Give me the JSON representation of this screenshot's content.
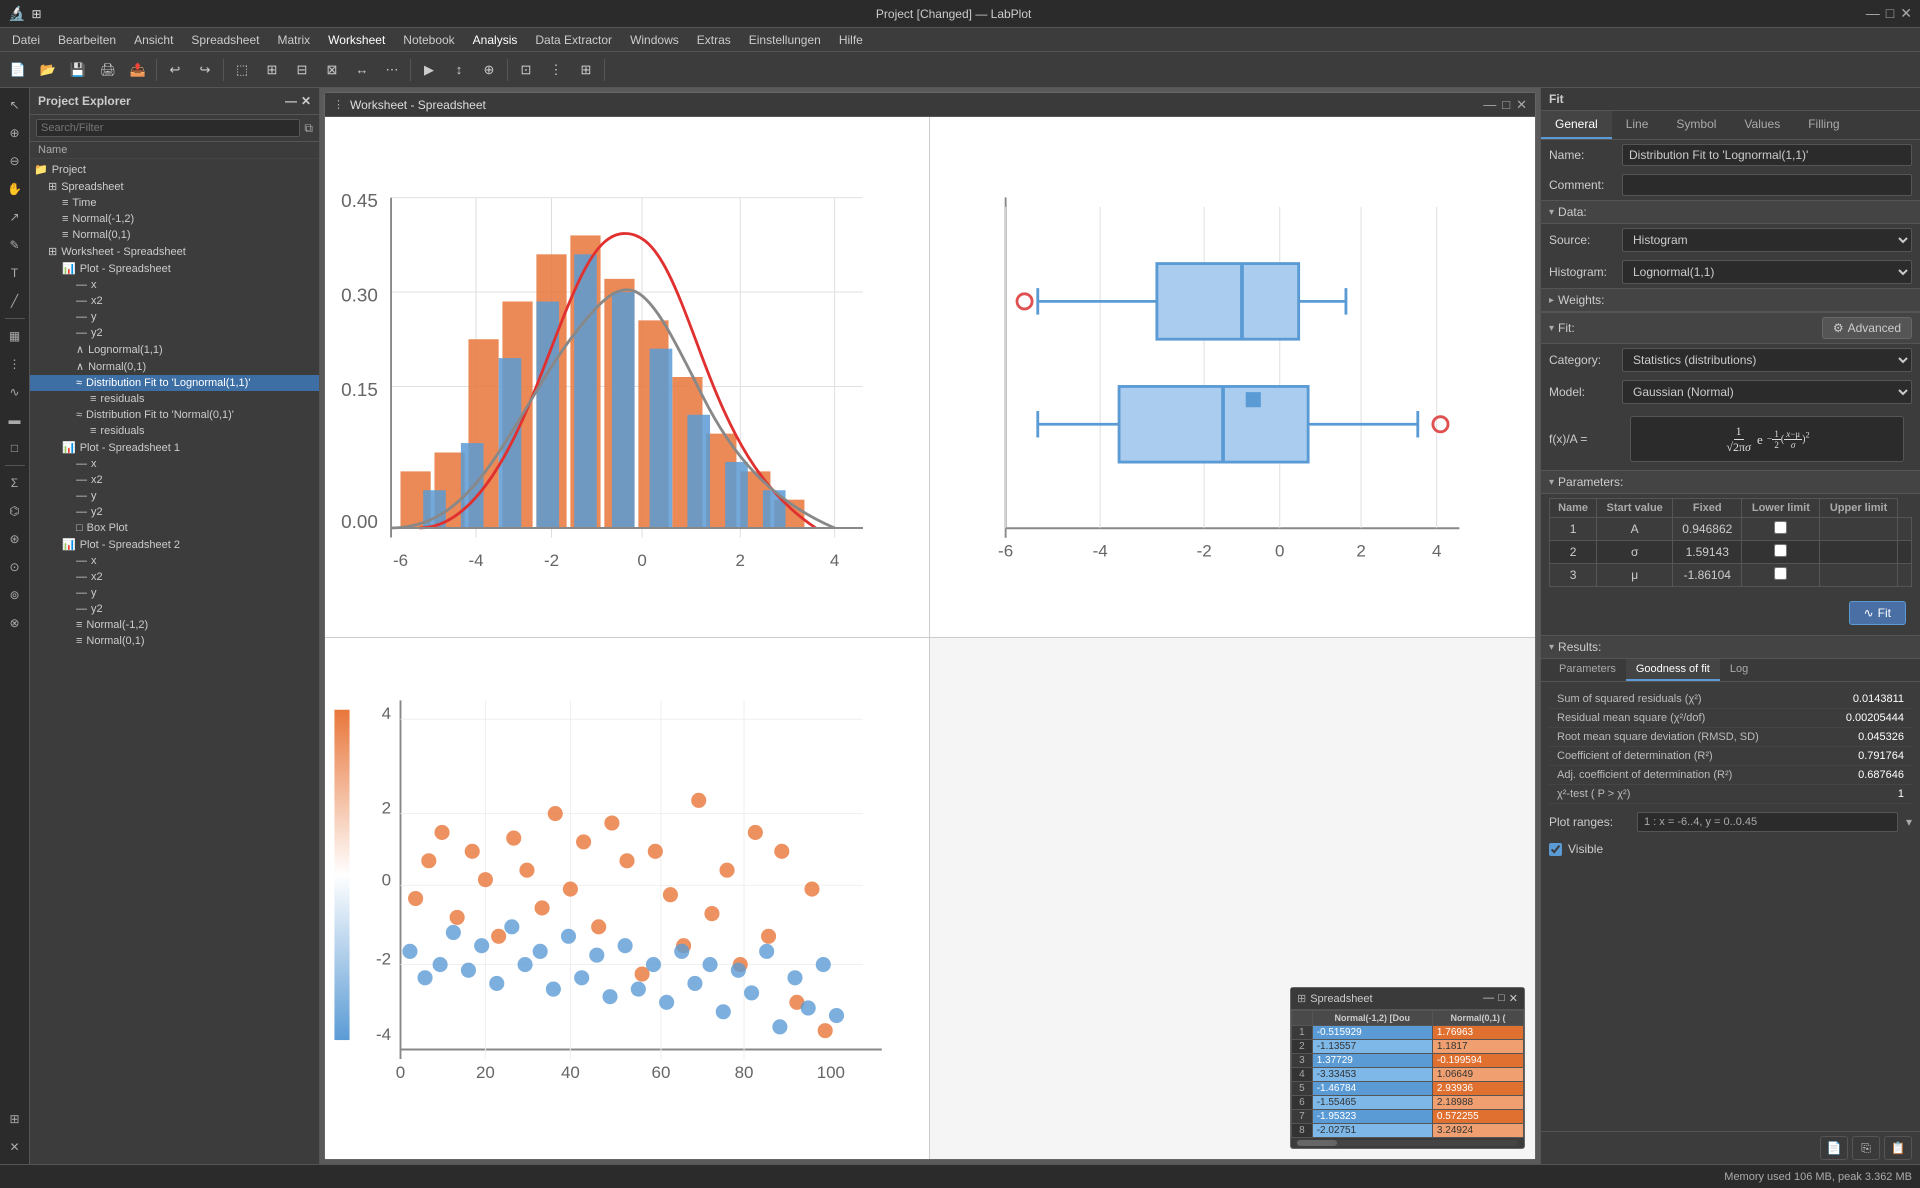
{
  "titlebar": {
    "title": "Project [Changed] — LabPlot",
    "minimize": "—",
    "maximize": "□",
    "close": "✕"
  },
  "menubar": {
    "items": [
      "Datei",
      "Bearbeiten",
      "Ansicht",
      "Spreadsheet",
      "Matrix",
      "Worksheet",
      "Notebook",
      "Analysis",
      "Data Extractor",
      "Windows",
      "Extras",
      "Einstellungen",
      "Hilfe"
    ]
  },
  "sidebar": {
    "header": "Project Explorer",
    "search_placeholder": "Search/Filter",
    "col_header": "Name",
    "tree": [
      {
        "label": "Project",
        "indent": 0,
        "icon": "📁"
      },
      {
        "label": "Spreadsheet",
        "indent": 1,
        "icon": "⊞"
      },
      {
        "label": "Time",
        "indent": 2,
        "icon": "≡"
      },
      {
        "label": "Normal(-1,2)",
        "indent": 2,
        "icon": "≡"
      },
      {
        "label": "Normal(0,1)",
        "indent": 2,
        "icon": "≡"
      },
      {
        "label": "Worksheet - Spreadsheet",
        "indent": 1,
        "icon": "⊞"
      },
      {
        "label": "Plot - Spreadsheet",
        "indent": 2,
        "icon": "📊"
      },
      {
        "label": "x",
        "indent": 3,
        "icon": "—"
      },
      {
        "label": "x2",
        "indent": 3,
        "icon": "—"
      },
      {
        "label": "y",
        "indent": 3,
        "icon": "—"
      },
      {
        "label": "y2",
        "indent": 3,
        "icon": "—"
      },
      {
        "label": "Lognormal(1,1)",
        "indent": 3,
        "icon": "∧"
      },
      {
        "label": "Normal(0,1)",
        "indent": 3,
        "icon": "∧"
      },
      {
        "label": "Distribution Fit to 'Lognormal(1,1)'",
        "indent": 3,
        "icon": "≈",
        "selected": true
      },
      {
        "label": "residuals",
        "indent": 4,
        "icon": "≡"
      },
      {
        "label": "Distribution Fit to 'Normal(0,1)'",
        "indent": 3,
        "icon": "≈"
      },
      {
        "label": "residuals",
        "indent": 4,
        "icon": "≡"
      },
      {
        "label": "Plot - Spreadsheet 1",
        "indent": 2,
        "icon": "📊"
      },
      {
        "label": "x",
        "indent": 3,
        "icon": "—"
      },
      {
        "label": "x2",
        "indent": 3,
        "icon": "—"
      },
      {
        "label": "y",
        "indent": 3,
        "icon": "—"
      },
      {
        "label": "y2",
        "indent": 3,
        "icon": "—"
      },
      {
        "label": "Box Plot",
        "indent": 3,
        "icon": "□"
      },
      {
        "label": "Plot - Spreadsheet 2",
        "indent": 2,
        "icon": "📊"
      },
      {
        "label": "x",
        "indent": 3,
        "icon": "—"
      },
      {
        "label": "x2",
        "indent": 3,
        "icon": "—"
      },
      {
        "label": "y",
        "indent": 3,
        "icon": "—"
      },
      {
        "label": "y2",
        "indent": 3,
        "icon": "—"
      },
      {
        "label": "Normal(-1,2)",
        "indent": 3,
        "icon": "≡"
      },
      {
        "label": "Normal(0,1)",
        "indent": 3,
        "icon": "≡"
      }
    ]
  },
  "worksheet": {
    "title": "Worksheet - Spreadsheet"
  },
  "spreadsheet_mini": {
    "title": "Spreadsheet",
    "col1": "Normal(-1,2) [Dou",
    "col2": "Normal(0,1) (",
    "rows": [
      {
        "num": 1,
        "v1": "-0.515929",
        "v2": "1.76963"
      },
      {
        "num": 2,
        "v1": "-1.13557",
        "v2": "1.1817"
      },
      {
        "num": 3,
        "v1": "1.37729",
        "v2": "-0.199594"
      },
      {
        "num": 4,
        "v1": "-3.33453",
        "v2": "1.06649"
      },
      {
        "num": 5,
        "v1": "-1.46784",
        "v2": "2.93936"
      },
      {
        "num": 6,
        "v1": "-1.55465",
        "v2": "2.18988"
      },
      {
        "num": 7,
        "v1": "-1.95323",
        "v2": "0.572255"
      },
      {
        "num": 8,
        "v1": "-2.02751",
        "v2": "3.24924"
      }
    ]
  },
  "right_panel": {
    "header": "Fit",
    "tabs": [
      "General",
      "Line",
      "Symbol",
      "Values",
      "Filling"
    ],
    "active_tab": "General",
    "name_label": "Name:",
    "name_value": "Distribution Fit to 'Lognormal(1,1)'",
    "comment_label": "Comment:",
    "comment_value": "",
    "data_section": "Data:",
    "source_label": "Source:",
    "source_value": "Histogram",
    "histogram_label": "Histogram:",
    "histogram_value": "Lognormal(1,1)",
    "weights_section": "Weights:",
    "fit_section": "Fit:",
    "advanced_btn": "Advanced",
    "category_label": "Category:",
    "category_value": "Statistics (distributions)",
    "model_label": "Model:",
    "model_value": "Gaussian (Normal)",
    "formula_prefix": "f(x)/A =",
    "formula": "1/(√2πσ) · e^(-1/2·((x-μ)/σ)²)",
    "params_section": "Parameters:",
    "params_cols": [
      "Name",
      "Start value",
      "Fixed",
      "Lower limit",
      "Upper limit"
    ],
    "params_rows": [
      {
        "num": 1,
        "name": "A",
        "start": "0.946862",
        "fixed": false,
        "lower": "",
        "upper": ""
      },
      {
        "num": 2,
        "name": "σ",
        "start": "1.59143",
        "fixed": false,
        "lower": "",
        "upper": ""
      },
      {
        "num": 3,
        "name": "μ",
        "start": "-1.86104",
        "fixed": false,
        "lower": "",
        "upper": ""
      }
    ],
    "fit_btn": "Fit",
    "results_section": "Results:",
    "sub_tabs": [
      "Parameters",
      "Goodness of fit",
      "Log"
    ],
    "active_sub_tab": "Goodness of fit",
    "results": [
      {
        "label": "Sum of squared residuals (χ²)",
        "value": "0.0143811"
      },
      {
        "label": "Residual mean square (χ²/dof)",
        "value": "0.00205444"
      },
      {
        "label": "Root mean square deviation (RMSD, SD)",
        "value": "0.045326"
      },
      {
        "label": "Coefficient of determination (R²)",
        "value": "0.791764"
      },
      {
        "label": "Adj. coefficient of determination (R²)",
        "value": "0.687646"
      },
      {
        "label": "χ²-test ( P > χ²)",
        "value": "1"
      }
    ],
    "plot_ranges_label": "Plot ranges:",
    "plot_ranges_value": "1 : x = -6..4, y = 0..0.45",
    "visible_label": "Visible",
    "visible_checked": true
  },
  "status_bar": {
    "text": "Memory used 106 MB, peak 3.362 MB"
  }
}
